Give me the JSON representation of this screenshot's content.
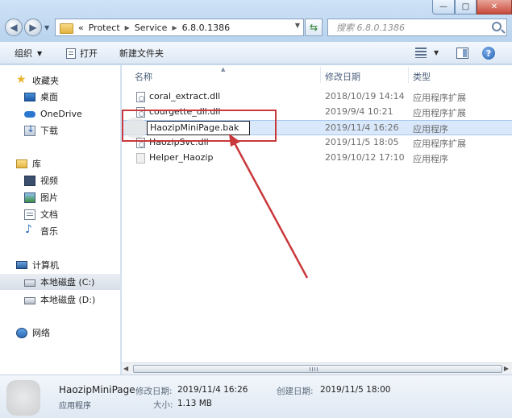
{
  "window": {
    "minimize_glyph": "—",
    "maximize_glyph": "□",
    "close_glyph": "✕"
  },
  "address": {
    "prefix": "«",
    "crumbs": [
      "Protect",
      "Service",
      "6.8.0.1386"
    ],
    "search_placeholder": "搜索 6.8.0.1386"
  },
  "toolbar": {
    "organize_label": "组织",
    "open_label": "打开",
    "new_folder_label": "新建文件夹"
  },
  "nav": {
    "favorites": "收藏夹",
    "desktop": "桌面",
    "onedrive": "OneDrive",
    "downloads": "下载",
    "libraries": "库",
    "videos": "视频",
    "pictures": "图片",
    "documents": "文档",
    "music": "音乐",
    "computer": "计算机",
    "drive_c": "本地磁盘 (C:)",
    "drive_d": "本地磁盘 (D:)",
    "network": "网络"
  },
  "columns": {
    "name": "名称",
    "modified": "修改日期",
    "type": "类型"
  },
  "files": [
    {
      "name": "coral_extract.dll",
      "date": "2018/10/19 14:14",
      "type": "应用程序扩展"
    },
    {
      "name": "courgette_dll.dll",
      "date": "2019/9/4 10:21",
      "type": "应用程序扩展"
    },
    {
      "name": "HaozipMiniPage.bak",
      "date": "2019/11/4 16:26",
      "type": "应用程序"
    },
    {
      "name": "HaozipSvc.dll",
      "date": "2019/11/5 18:05",
      "type": "应用程序扩展"
    },
    {
      "name": "Helper_Haozip",
      "date": "2019/10/12 17:10",
      "type": "应用程序"
    }
  ],
  "details": {
    "name": "HaozipMiniPage",
    "type": "应用程序",
    "modified_label": "修改日期:",
    "modified_value": "2019/11/4 16:26",
    "created_label": "创建日期:",
    "created_value": "2019/11/5 18:00",
    "size_label": "大小:",
    "size_value": "1.13 MB"
  },
  "colors": {
    "callout": "#c9383b",
    "selection": "#d9e8fb"
  }
}
